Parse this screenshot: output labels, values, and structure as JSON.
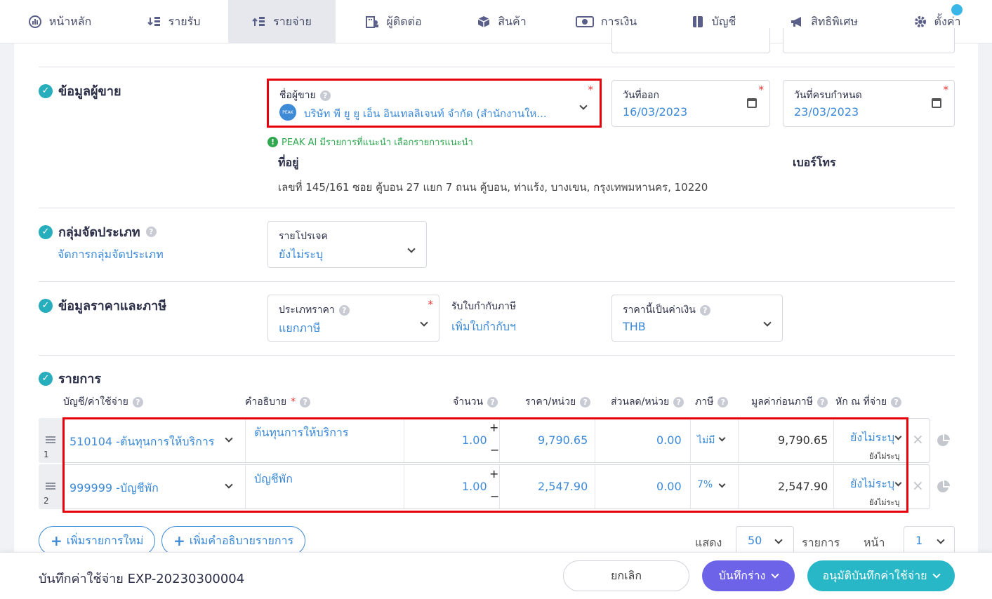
{
  "nav": [
    {
      "label": "หน้าหลัก",
      "icon": "dashboard-icon"
    },
    {
      "label": "รายรับ",
      "icon": "income-icon"
    },
    {
      "label": "รายจ่าย",
      "icon": "expense-icon",
      "active": true
    },
    {
      "label": "ผู้ติดต่อ",
      "icon": "contacts-icon"
    },
    {
      "label": "สินค้า",
      "icon": "box-icon"
    },
    {
      "label": "การเงิน",
      "icon": "money-icon"
    },
    {
      "label": "บัญชี",
      "icon": "ledger-icon"
    },
    {
      "label": "สิทธิพิเศษ",
      "icon": "megaphone-icon"
    },
    {
      "label": "ตั้งค่า",
      "icon": "gear-icon"
    }
  ],
  "vendor": {
    "section_title": "ข้อมูลผู้ขาย",
    "name_label": "ชื่อผู้ขาย",
    "name_value": "บริษัท พี ยู ยู เอ็น อินเทลลิเจนท์ จำกัด (สำนักงานให...",
    "avatar_text": "PEAK",
    "issue_label": "วันที่ออก",
    "issue_date": "16/03/2023",
    "due_label": "วันที่ครบกำหนด",
    "due_date": "23/03/2023",
    "ai_hint": "PEAK AI มีรายการที่แนะนำ เลือกรายการแนะนำ",
    "address_label": "ที่อยู่",
    "address": "เลขที่ 145/161 ซอย คู้บอน 27 แยก 7 ถนน คู้บอน, ท่าแร้ง, บางเขน, กรุงเทพมหานคร, 10220",
    "phone_label": "เบอร์โทร"
  },
  "category": {
    "section_title": "กลุ่มจัดประเภท",
    "manage_link": "จัดการกลุ่มจัดประเภท",
    "project_label": "รายโปรเจค",
    "project_value": "ยังไม่ระบุ"
  },
  "pricing": {
    "section_title": "ข้อมูลราคาและภาษี",
    "price_type_label": "ประเภทราคา",
    "price_type_value": "แยกภาษี",
    "tax_invoice_label": "รับใบกำกับภาษี",
    "tax_invoice_link": "เพิ่มใบกำกับฯ",
    "currency_label": "ราคานี้เป็นค่าเงิน",
    "currency_value": "THB"
  },
  "items": {
    "section_title": "รายการ",
    "headers": {
      "account": "บัญชี/ค่าใช้จ่าย",
      "description": "คำอธิบาย",
      "qty": "จำนวน",
      "price": "ราคา/หน่วย",
      "discount": "ส่วนลด/หน่วย",
      "tax": "ภาษี",
      "pretax": "มูลค่าก่อนภาษี",
      "withholding": "หัก ณ ที่จ่าย"
    },
    "rows": [
      {
        "no": "1",
        "account": "510104 -ต้นทุนการให้บริการ",
        "description": "ต้นทุนการให้บริการ",
        "qty": "1.00",
        "price": "9,790.65",
        "discount": "0.00",
        "tax": "ไม่มี",
        "pretax": "9,790.65",
        "wht": "ยังไม่ระบุ",
        "wht_sub": "ยังไม่ระบุ"
      },
      {
        "no": "2",
        "account": "999999 -บัญชีพัก",
        "description": "บัญชีพัก",
        "qty": "1.00",
        "price": "2,547.90",
        "discount": "0.00",
        "tax": "7%",
        "pretax": "2,547.90",
        "wht": "ยังไม่ระบุ",
        "wht_sub": "ยังไม่ระบุ"
      }
    ],
    "add_item": "เพิ่มรายการใหม่",
    "add_desc": "เพิ่มคำอธิบายรายการ",
    "show_label": "แสดง",
    "page_size": "50",
    "items_label": "รายการ",
    "page_label": "หน้า",
    "page_value": "1"
  },
  "footer": {
    "title": "บันทึกค่าใช้จ่าย EXP-20230300004",
    "cancel": "ยกเลิก",
    "save_draft": "บันทึกร่าง",
    "approve": "อนุมัติบันทึกค่าใช้จ่าย"
  },
  "colors": {
    "accent": "#3d8ad6",
    "check": "#27aebd",
    "draft_button": "#6c63e8",
    "approve_button": "#27b7c7",
    "highlight": "#e8000b"
  }
}
